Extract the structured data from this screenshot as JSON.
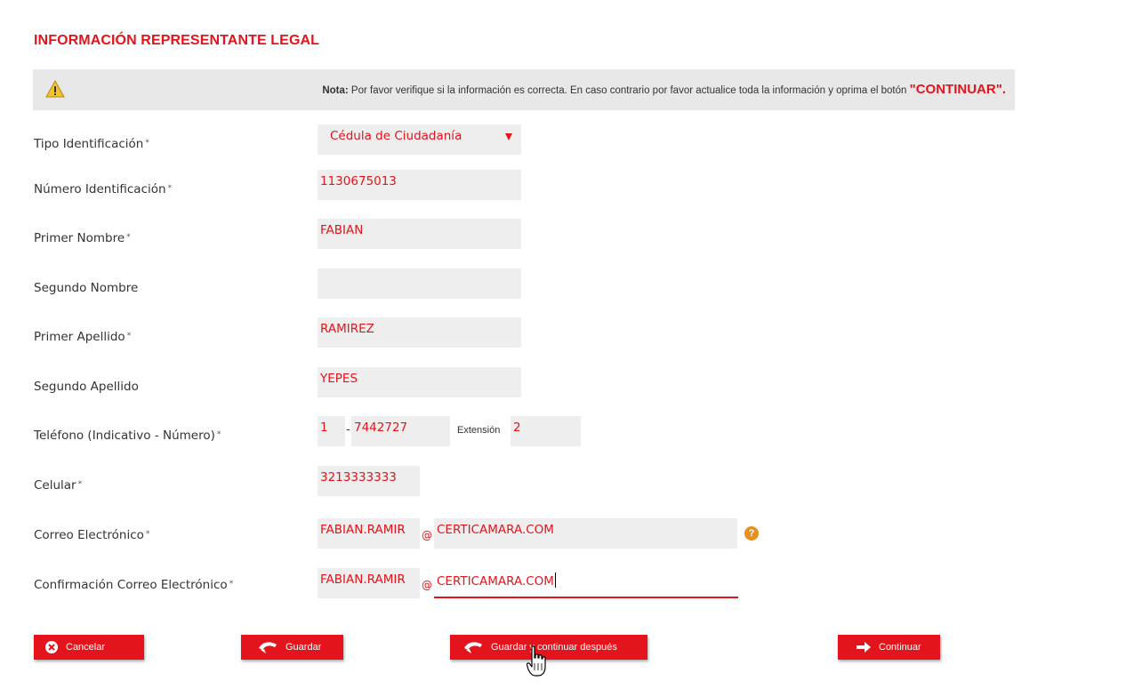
{
  "section": {
    "title": "INFORMACIÓN REPRESENTANTE LEGAL"
  },
  "note": {
    "label": "Nota:",
    "text": " Por favor verifique si la información es correcta. En caso contrario por favor actualice toda la información y oprima el botón ",
    "cta": "\"CONTINUAR\".",
    "icon": "warning-icon"
  },
  "form": {
    "tipo_id": {
      "label": "Tipo Identificación",
      "required": "*",
      "value": "Cédula de Ciudadanía"
    },
    "numero_id": {
      "label": "Número Identificación",
      "required": "*",
      "value": "1130675013"
    },
    "primer_nombre": {
      "label": "Primer Nombre",
      "required": "*",
      "value": "FABIAN"
    },
    "segundo_nombre": {
      "label": "Segundo Nombre",
      "value": ""
    },
    "primer_apellido": {
      "label": "Primer Apellido",
      "required": "*",
      "value": "RAMIREZ"
    },
    "segundo_apellido": {
      "label": "Segundo Apellido",
      "value": "YEPES"
    },
    "telefono": {
      "label": "Teléfono (Indicativo - Número)",
      "required": "*",
      "indicativo": "1",
      "separator": "-",
      "numero": "7442727",
      "ext_label": "Extensión",
      "extension": "2"
    },
    "celular": {
      "label": "Celular",
      "required": "*",
      "value": "3213333333"
    },
    "correo": {
      "label": "Correo Electrónico",
      "required": "*",
      "user": "FABIAN.RAMIR",
      "at": "@",
      "domain": "CERTICAMARA.COM",
      "help_icon": "help-icon"
    },
    "confirmacion": {
      "label": "Confirmación Correo Electrónico",
      "required": "*",
      "user": "FABIAN.RAMIR",
      "at": "@",
      "domain": "CERTICAMARA.COM"
    }
  },
  "buttons": {
    "cancelar": "Cancelar",
    "guardar": "Guardar",
    "guardar_continuar": "Guardar y continuar después",
    "continuar": "Continuar"
  },
  "colors": {
    "accent": "#e3141b",
    "field_bg": "#eeeeee",
    "note_bg": "#e8e8e8",
    "help": "#e8901c"
  }
}
